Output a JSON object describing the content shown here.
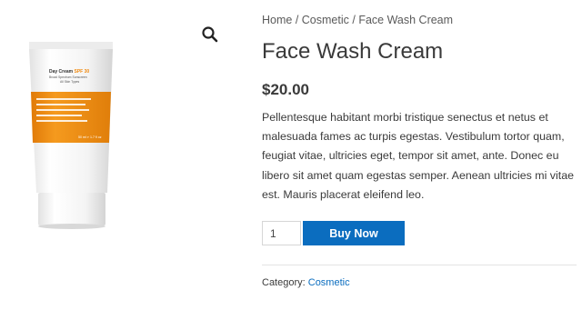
{
  "breadcrumb": {
    "home": "Home",
    "category": "Cosmetic",
    "current": "Face Wash Cream",
    "separator": "/"
  },
  "product": {
    "title": "Face Wash Cream",
    "price": "$20.00",
    "description": "Pellentesque habitant morbi tristique senectus et netus et malesuada fames ac turpis egestas. Vestibulum tortor quam, feugiat vitae, ultricies eget, tempor sit amet, ante. Donec eu libero sit amet quam egestas semper. Aenean ultricies mi vitae est. Mauris placerat eleifend leo.",
    "quantity": "1",
    "buy_label": "Buy Now",
    "category_label": "Category:",
    "category_value": "Cosmetic"
  },
  "image": {
    "icon": "zoom-search-icon",
    "tube_label_title": "Day Cream",
    "tube_label_spf": "SPF 30",
    "tube_label_line1": "Broad Spectrum Sunscreen",
    "tube_label_line2": "All Skin Types",
    "tube_volume": "50 ml ℮ 1.7 fl oz"
  },
  "colors": {
    "accent": "#0b6dbf",
    "tube_orange": "#f08a10",
    "text": "#3a3a3a"
  }
}
